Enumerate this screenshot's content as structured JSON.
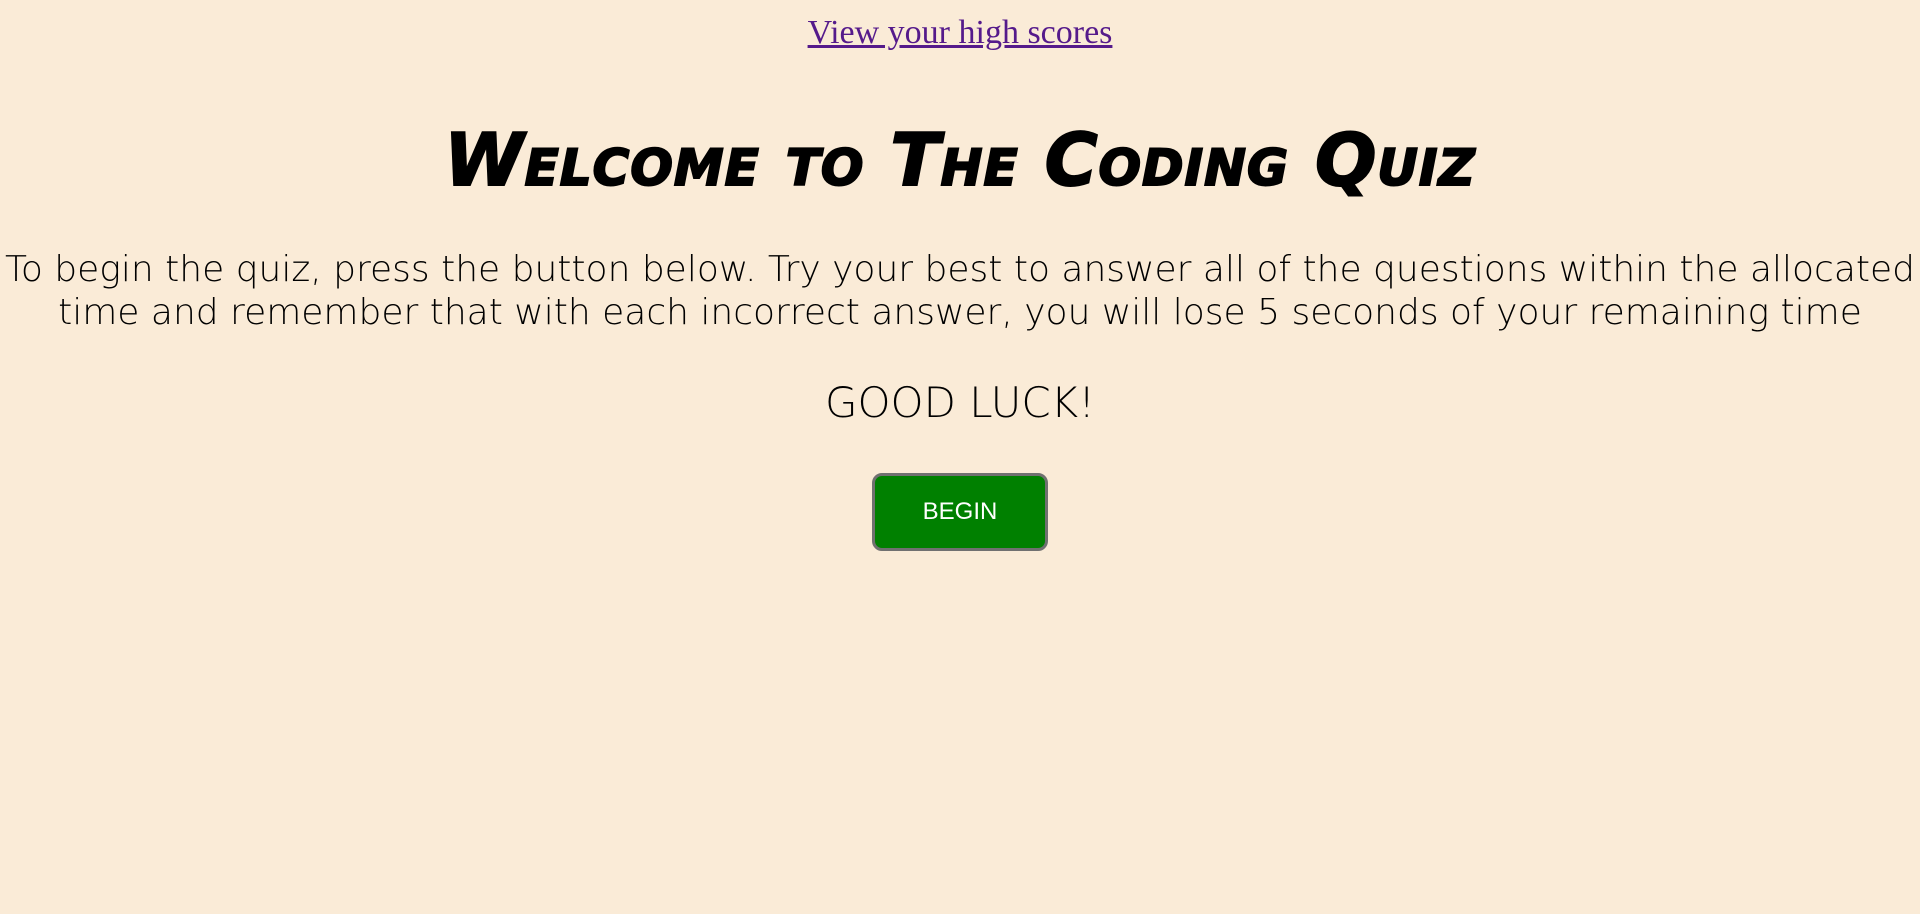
{
  "header": {
    "high_scores_link": "View your high scores"
  },
  "main": {
    "title": "Welcome to The Coding Quiz",
    "intro": "To begin the quiz, press the button below. Try your best to answer all of the questions within the allocated time and remember that with each incorrect answer, you will lose 5 seconds of your remaining time",
    "good_luck": "GOOD LUCK!",
    "begin_button": "BEGIN"
  },
  "colors": {
    "background": "#faebd7",
    "link": "#551a8b",
    "button": "#008000",
    "button_text": "#ffffff"
  }
}
